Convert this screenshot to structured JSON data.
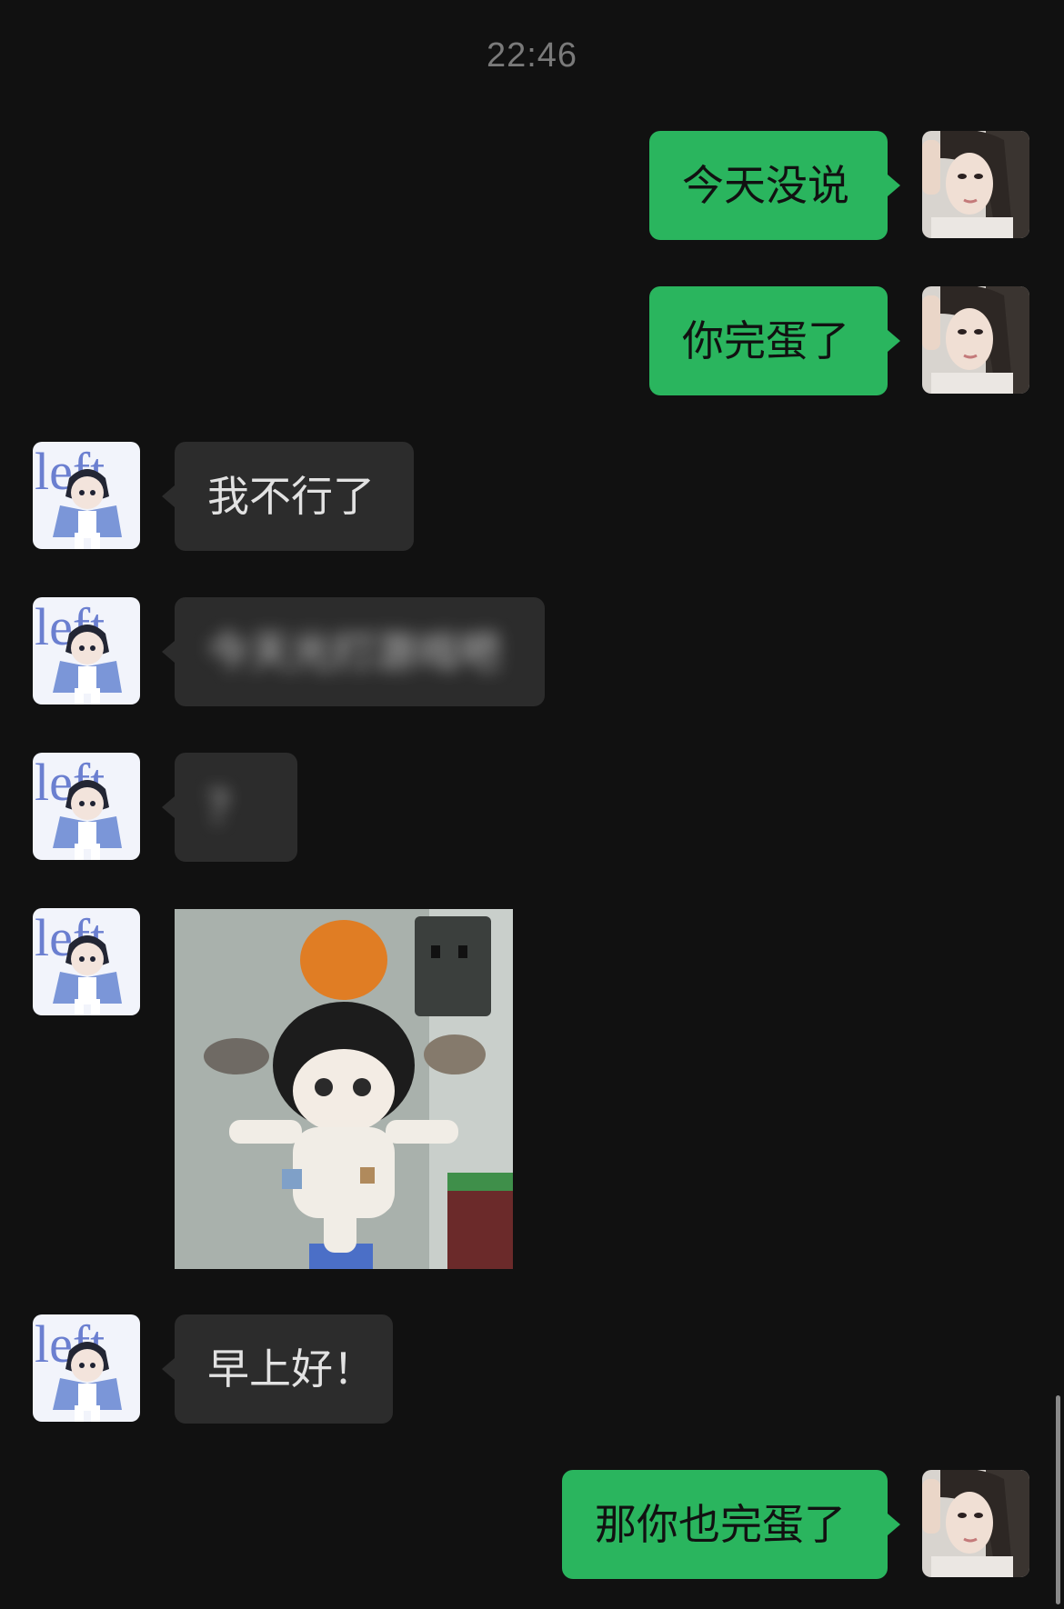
{
  "chat": {
    "timestamp": "22:46",
    "messages": [
      {
        "direction": "out",
        "type": "text",
        "text": "今天没说"
      },
      {
        "direction": "out",
        "type": "text",
        "text": "你完蛋了"
      },
      {
        "direction": "in",
        "type": "text",
        "text": "我不行了"
      },
      {
        "direction": "in",
        "type": "text",
        "text": "今天光打游戏吧",
        "blurred": true
      },
      {
        "direction": "in",
        "type": "text",
        "text": "？",
        "blurred": true
      },
      {
        "direction": "in",
        "type": "image",
        "icon": "plush-doll-photo"
      },
      {
        "direction": "in",
        "type": "text",
        "text": "早上好！"
      },
      {
        "direction": "out",
        "type": "text",
        "text": "那你也完蛋了"
      }
    ]
  },
  "avatars": {
    "self": {
      "icon": "woman-portrait-avatar"
    },
    "contact": {
      "icon": "anime-boy-avatar",
      "text": "left"
    }
  },
  "colors": {
    "background": "#111111",
    "outgoing_bubble": "#2ab55e",
    "incoming_bubble": "#2c2c2c",
    "timestamp": "#7a7a7a"
  }
}
